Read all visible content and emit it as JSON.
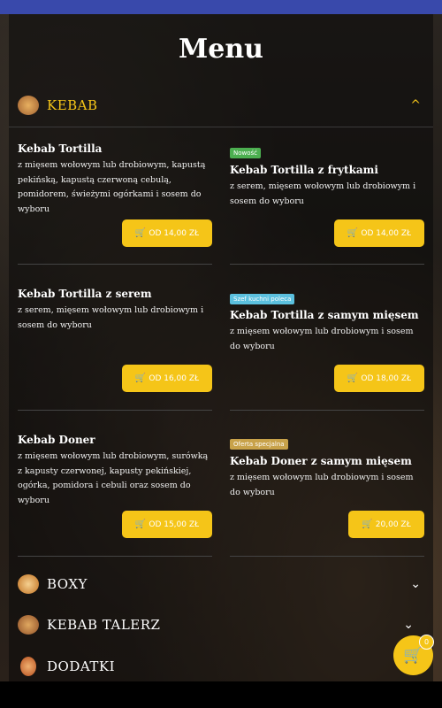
{
  "page_title": "Menu",
  "categories": {
    "kebab": {
      "label": "KEBAB",
      "chevron": "^"
    },
    "boxy": {
      "label": "BOXY",
      "chevron": "⌄"
    },
    "kebab_talerz": {
      "label": "KEBAB TALERZ",
      "chevron": "⌄"
    },
    "dodatki": {
      "label": "DODATKI"
    }
  },
  "items": [
    {
      "name": "Kebab Tortilla",
      "desc": "z mięsem wołowym lub drobiowym, kapustą pekińską, kapustą czerwoną cebulą, pomidorem, świeżymi ogórkami i sosem do wyboru",
      "price": "OD 14,00 ZŁ"
    },
    {
      "badge": "Nowość",
      "name": "Kebab Tortilla z frytkami",
      "desc": "z serem, mięsem wołowym lub drobiowym i sosem do wyboru",
      "price": "OD 14,00 ZŁ"
    },
    {
      "name": "Kebab Tortilla z serem",
      "desc": "z serem, mięsem wołowym lub drobiowym i sosem do wyboru",
      "price": "OD 16,00 ZŁ"
    },
    {
      "badge": "Szef kuchni poleca",
      "name": "Kebab Tortilla z samym mięsem",
      "desc": "z mięsem wołowym lub drobiowym i sosem do wyboru",
      "price": "OD 18,00 ZŁ"
    },
    {
      "name": "Kebab Doner",
      "desc": "z mięsem wołowym lub drobiowym, surówką z kapusty czerwonej, kapusty pekińskiej, ogórka, pomidora i cebuli oraz sosem do wyboru",
      "price": "OD 15,00 ZŁ"
    },
    {
      "badge": "Oferta specjalna",
      "name": "Kebab Doner z samym mięsem",
      "desc": "z mięsem wołowym lub drobiowym i sosem do wyboru",
      "price": "20,00 ZŁ"
    }
  ],
  "cart": {
    "count": "0",
    "icon": "cart-icon"
  },
  "colors": {
    "accent": "#f5c518",
    "badge_new": "#4caf50",
    "badge_chef": "#5bc0de",
    "badge_special": "#c8a24a"
  }
}
